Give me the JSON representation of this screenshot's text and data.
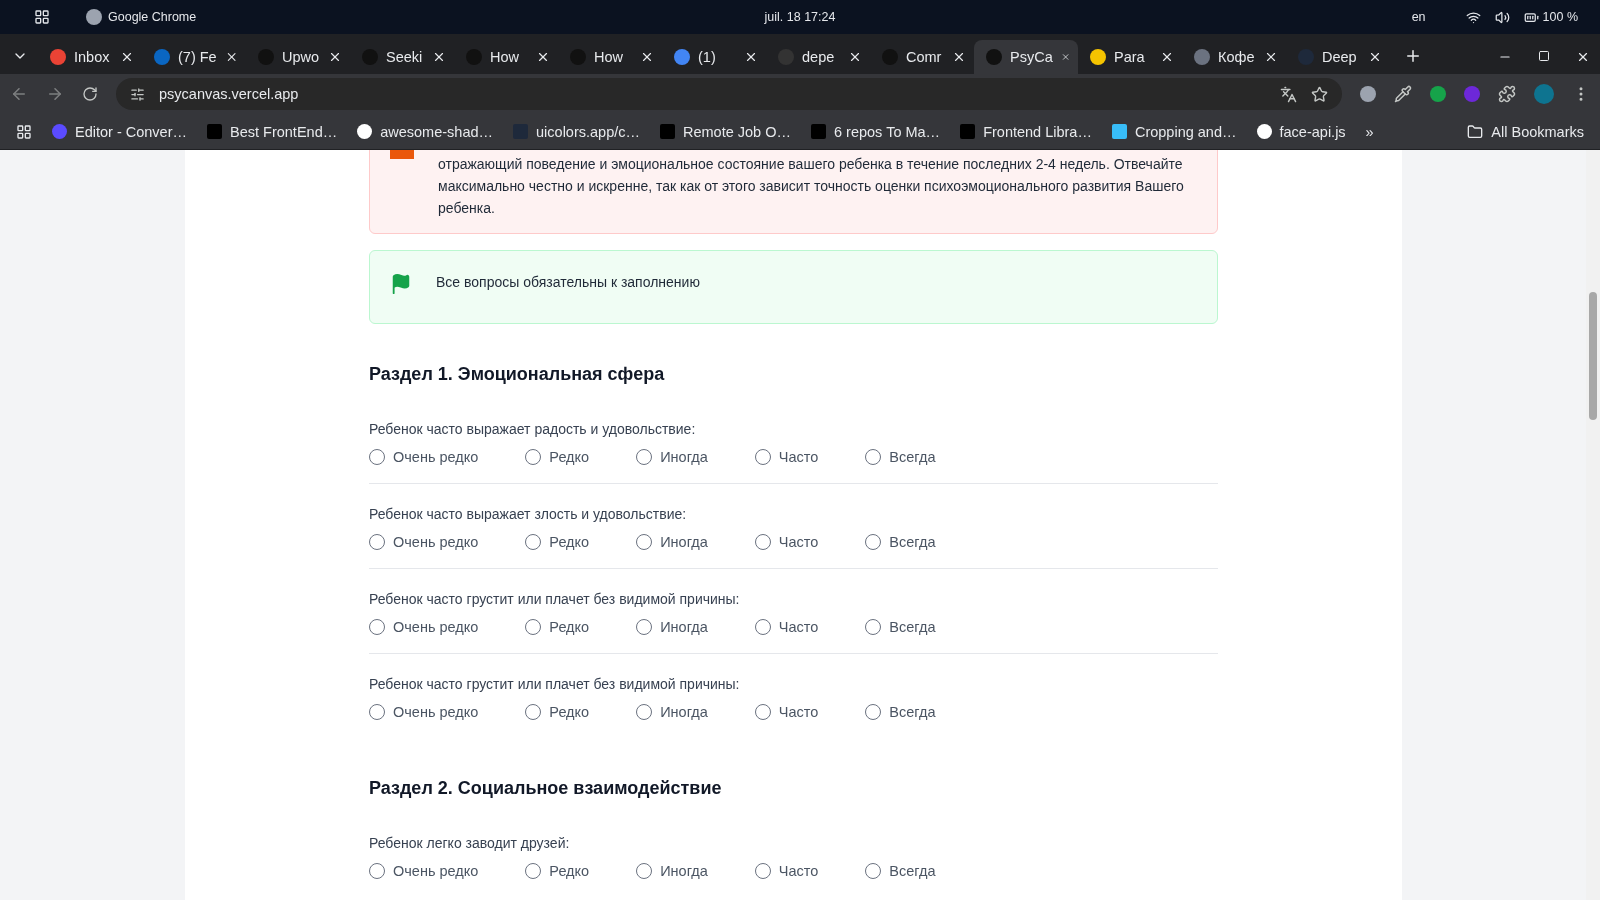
{
  "system_bar": {
    "app": "Google Chrome",
    "clock": "juil. 18  17:24",
    "language": "en",
    "battery": "100 %"
  },
  "tabs": [
    {
      "title": "Inbox",
      "selected": false
    },
    {
      "title": "(7) Fe",
      "selected": false
    },
    {
      "title": "Upwo",
      "selected": false
    },
    {
      "title": "Seeki",
      "selected": false
    },
    {
      "title": "How",
      "selected": false
    },
    {
      "title": "How",
      "selected": false
    },
    {
      "title": "(1)",
      "selected": false
    },
    {
      "title": "depe",
      "selected": false
    },
    {
      "title": "Comr",
      "selected": false
    },
    {
      "title": "PsyCa",
      "selected": true
    },
    {
      "title": "Para",
      "selected": false
    },
    {
      "title": "Кофе",
      "selected": false
    },
    {
      "title": "Deep",
      "selected": false
    }
  ],
  "address_bar": {
    "url": "psycanvas.vercel.app"
  },
  "bookmarks": [
    "Editor - Conver…",
    "Best FrontEnd…",
    "awesome-shad…",
    "uicolors.app/c…",
    "Remote Job O…",
    "6 repos To Ma…",
    "Frontend Libra…",
    "Cropping and…",
    "face-api.js"
  ],
  "bookmarks_more": "»",
  "all_bookmarks": "All Bookmarks",
  "intro_notice": "отражающий поведение и эмоциональное состояние вашего ребенка в течение последних 2-4 недель. Отвечайте максимально честно и искренне, так как от этого зависит точность оценки психоэмоционального развития Вашего ребенка.",
  "required_notice": "Все вопросы обязательны к заполнению",
  "sections": [
    {
      "title": "Раздел 1. Эмоциональная сфера",
      "questions": [
        {
          "text": "Ребенок часто выражает радость и удовольствие:",
          "options": [
            {
              "label": "Очень редко",
              "selected": false
            },
            {
              "label": "Редко",
              "selected": false
            },
            {
              "label": "Иногда",
              "selected": false
            },
            {
              "label": "Часто",
              "selected": false
            },
            {
              "label": "Всегда",
              "selected": false
            }
          ]
        },
        {
          "text": "Ребенок часто выражает злость и удовольствие:",
          "options": [
            {
              "label": "Очень редко",
              "selected": false
            },
            {
              "label": "Редко",
              "selected": false
            },
            {
              "label": "Иногда",
              "selected": false
            },
            {
              "label": "Часто",
              "selected": false
            },
            {
              "label": "Всегда",
              "selected": false
            }
          ]
        },
        {
          "text": "Ребенок часто грустит или плачет без видимой причины:",
          "options": [
            {
              "label": "Очень редко",
              "selected": false
            },
            {
              "label": "Редко",
              "selected": false
            },
            {
              "label": "Иногда",
              "selected": false
            },
            {
              "label": "Часто",
              "selected": false
            },
            {
              "label": "Всегда",
              "selected": false
            }
          ]
        },
        {
          "text": "Ребенок часто грустит или плачет без видимой причины:",
          "options": [
            {
              "label": "Очень редко",
              "selected": false
            },
            {
              "label": "Редко",
              "selected": false
            },
            {
              "label": "Иногда",
              "selected": false
            },
            {
              "label": "Часто",
              "selected": false
            },
            {
              "label": "Всегда",
              "selected": false
            }
          ]
        }
      ]
    },
    {
      "title": "Раздел 2. Социальное взаимодействие",
      "questions": [
        {
          "text": "Ребенок легко заводит друзей:",
          "options": [
            {
              "label": "Очень редко",
              "selected": false
            },
            {
              "label": "Редко",
              "selected": false
            },
            {
              "label": "Иногда",
              "selected": false
            },
            {
              "label": "Часто",
              "selected": false
            },
            {
              "label": "Всегда",
              "selected": false
            }
          ]
        }
      ]
    }
  ]
}
